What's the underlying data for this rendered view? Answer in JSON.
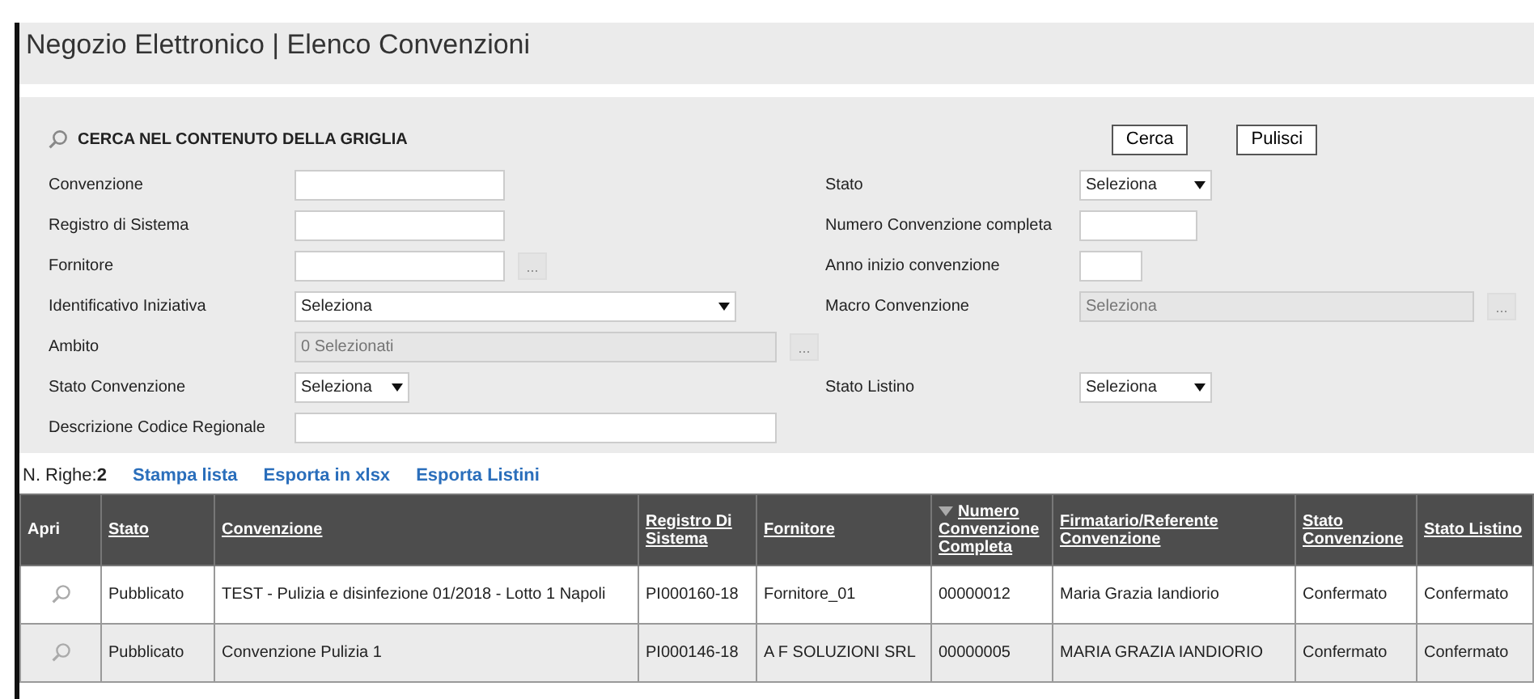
{
  "page_title": "Negozio Elettronico | Elenco Convenzioni",
  "search": {
    "heading": "CERCA NEL CONTENUTO DELLA GRIGLIA",
    "buttons": [
      "Cerca",
      "Pulisci"
    ],
    "rows": [
      {
        "left": {
          "label": "Convenzione",
          "kind": "text"
        },
        "right": {
          "label": "Stato",
          "kind": "select",
          "value": "Seleziona"
        }
      },
      {
        "left": {
          "label": "Registro di Sistema",
          "kind": "text"
        },
        "right": {
          "label": "Numero Convenzione completa",
          "kind": "text"
        }
      },
      {
        "left": {
          "label": "Fornitore",
          "kind": "lookup",
          "button": "..."
        },
        "right": {
          "label": "Anno inizio convenzione",
          "kind": "text"
        }
      },
      {
        "left": {
          "label": "Identificativo Iniziativa",
          "kind": "select",
          "value": "Seleziona"
        },
        "right": {
          "label": "Macro Convenzione",
          "kind": "picker",
          "placeholder": "Seleziona",
          "button": "..."
        }
      },
      {
        "left": {
          "label": "Ambito",
          "kind": "picker",
          "placeholder": "0 Selezionati",
          "button": "..."
        }
      },
      {
        "left": {
          "label": "Stato Convenzione",
          "kind": "select",
          "value": "Seleziona"
        },
        "right": {
          "label": "Stato Listino",
          "kind": "select",
          "value": "Seleziona"
        }
      },
      {
        "left": {
          "label": "Descrizione Codice Regionale",
          "kind": "text"
        }
      }
    ]
  },
  "results": {
    "count_label": "N. Righe:",
    "count": "2",
    "actions": [
      "Stampa lista",
      "Esporta in xlsx",
      "Esporta Listini"
    ]
  },
  "table": {
    "columns": [
      {
        "label": "Apri",
        "sortable": false,
        "sorted": false
      },
      {
        "label": "Stato",
        "sortable": true,
        "sorted": false
      },
      {
        "label": "Convenzione",
        "sortable": true,
        "sorted": false
      },
      {
        "label": "Registro Di Sistema",
        "sortable": true,
        "sorted": false
      },
      {
        "label": "Fornitore",
        "sortable": true,
        "sorted": false
      },
      {
        "label": "Numero Convenzione Completa",
        "sortable": true,
        "sorted": true
      },
      {
        "label": "Firmatario/Referente Convenzione",
        "sortable": true,
        "sorted": false
      },
      {
        "label": "Stato Convenzione",
        "sortable": true,
        "sorted": false
      },
      {
        "label": "Stato Listino",
        "sortable": true,
        "sorted": false
      }
    ],
    "rows": [
      {
        "cells": [
          "",
          "Pubblicato",
          "TEST - Pulizia e disinfezione 01/2018 - Lotto 1 Napoli",
          "PI000160-18",
          "Fornitore_01",
          "00000012",
          "Maria Grazia Iandiorio",
          "Confermato",
          "Confermato"
        ]
      },
      {
        "cells": [
          "",
          "Pubblicato",
          "Convenzione Pulizia 1",
          "PI000146-18",
          "A F SOLUZIONI SRL",
          "00000005",
          "MARIA GRAZIA IANDIORIO",
          "Confermato",
          "Confermato"
        ]
      }
    ]
  }
}
